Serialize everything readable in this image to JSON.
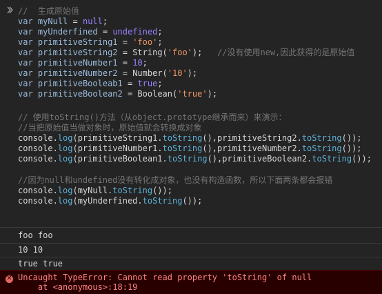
{
  "code": {
    "l1_comment": "//  生成原始值",
    "l2": {
      "kw": "var",
      "id": "myNull",
      "op": " = ",
      "val": "null",
      "end": ";"
    },
    "l3": {
      "kw": "var",
      "id": "myUnderfined",
      "op": " = ",
      "val": "undefined",
      "end": ";"
    },
    "l4": {
      "kw": "var",
      "id": "primitiveString1",
      "op": " = ",
      "val": "'foo'",
      "end": ";"
    },
    "l5": {
      "kw": "var",
      "id": "primitiveString2",
      "op": " = String(",
      "val": "'foo'",
      "end": ");",
      "comment": "//没有使用new,因此获得的是原始值"
    },
    "l6": {
      "kw": "var",
      "id": "primitiveNumber1",
      "op": " = ",
      "val": "10",
      "end": ";"
    },
    "l7": {
      "kw": "var",
      "id": "primitiveNumber2",
      "op": " = Number(",
      "val": "'10'",
      "end": ");"
    },
    "l8": {
      "kw": "var",
      "id": "primitiveBooleab1",
      "op": " = ",
      "val": "true",
      "end": ";"
    },
    "l9": {
      "kw": "var",
      "id": "primitiveBoolean2",
      "op": " = Boolean(",
      "val": "'true'",
      "end": ");"
    },
    "l11_comment": "// 使用toString()方法（从object.prototype继承而来）来演示：",
    "l12_comment": "//当把原始值当做对象时，原始值就会转换成对象",
    "l13": "console.log(primitiveString1.toString(),primitiveString2.toString());",
    "l14": "console.log(primitiveNumber1.toString(),primitiveNumber2.toString());",
    "l15": "console.log(primitiveBoolean1.toString(),primitiveBoolean2.toString());",
    "l17_comment": "//因为null和undefined没有转化成对象，也没有构造函数，所以下面两条都会报错",
    "l18": "console.log(myNull.toString());",
    "l19": "console.log(myUnderfined.toString());"
  },
  "output": {
    "line1": "foo foo",
    "line2": "10 10",
    "line3": "true true"
  },
  "error": {
    "icon": "error-icon",
    "message": "Uncaught TypeError: Cannot read property 'toString' of null",
    "location": "    at <anonymous>:18:19"
  },
  "colors": {
    "background": "#242424",
    "error_bg": "#290000",
    "error_text": "#fe8080"
  }
}
